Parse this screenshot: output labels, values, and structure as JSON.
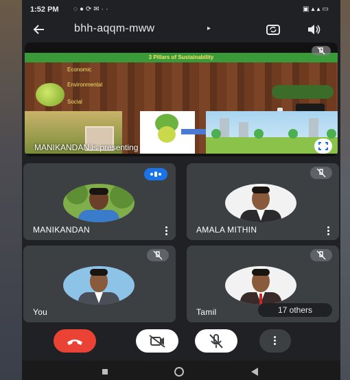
{
  "status_bar": {
    "time": "1:52 PM",
    "left_icons": [
      "notification-icon",
      "chat-icon",
      "sync-icon",
      "mail-icon",
      "more-dots-icon"
    ],
    "right_icons": [
      "volte-icon",
      "signal-icon",
      "battery-icon"
    ]
  },
  "meeting": {
    "code": "bhh-aqqm-mww",
    "caret": "▸"
  },
  "presentation": {
    "slide_title": "3 Pillars of Sustainability",
    "labels": [
      "Economic",
      "Environmental",
      "Social"
    ],
    "presenter_text": "MANIKANDAN is presenting"
  },
  "participants": [
    {
      "name": "MANIKANDAN",
      "status": "speaking"
    },
    {
      "name": "AMALA MITHIN",
      "status": "muted"
    },
    {
      "name": "You",
      "status": "muted"
    },
    {
      "name": "Tamil",
      "status": "muted"
    }
  ],
  "others_chip": "17 others",
  "controls": [
    "end-call",
    "camera-off",
    "mic-off",
    "more-options"
  ],
  "colors": {
    "end_call": "#ea4335",
    "speaking_badge": "#1a73e8",
    "tile_bg": "#3c4043",
    "app_bg": "#202124"
  }
}
